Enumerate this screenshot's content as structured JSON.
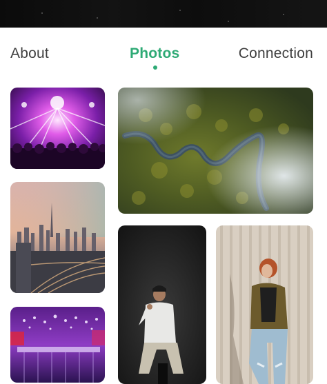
{
  "tabs": [
    {
      "label": "About",
      "active": false
    },
    {
      "label": "Photos",
      "active": true
    },
    {
      "label": "Connection",
      "active": false
    }
  ],
  "accent_color": "#2eaa75",
  "photos": [
    {
      "subject": "concert-crowd-lights"
    },
    {
      "subject": "city-skyline-highway"
    },
    {
      "subject": "purple-event-hall"
    },
    {
      "subject": "aerial-river-forest"
    },
    {
      "subject": "man-seated-dark-backdrop"
    },
    {
      "subject": "woman-leaning-wall"
    }
  ]
}
